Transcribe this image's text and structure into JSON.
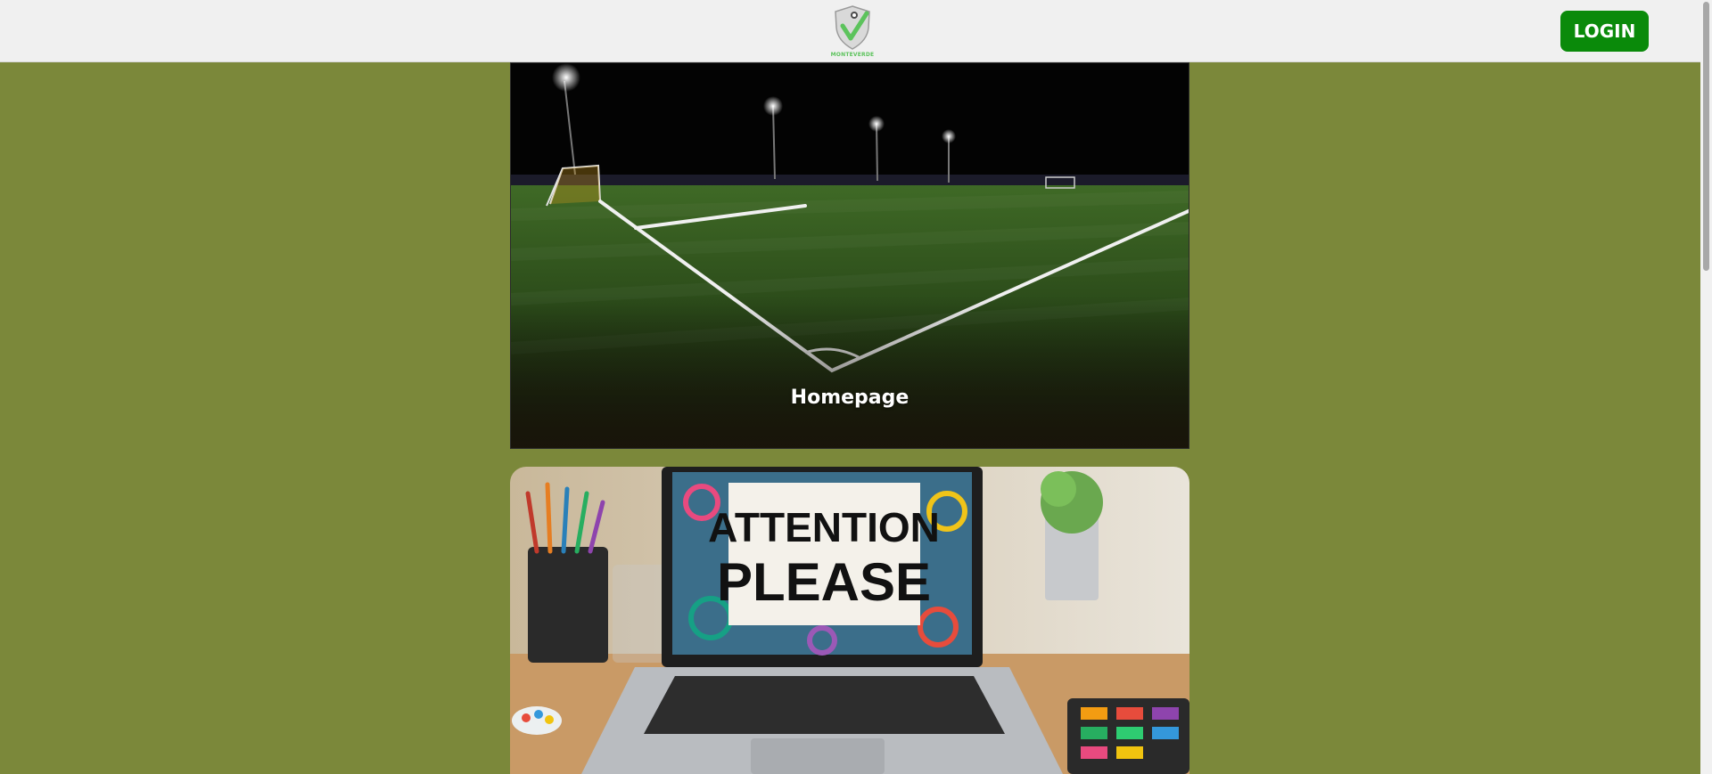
{
  "header": {
    "logo_text": "MONTEVERDE",
    "login_label": "LOGIN"
  },
  "cards": [
    {
      "title": "Homepage",
      "image": "night-soccer-field"
    },
    {
      "image": "laptop-attention-please",
      "sign_line1": "ATTENTION",
      "sign_line2": "PLEASE"
    }
  ],
  "colors": {
    "page_background": "#7b883a",
    "header_background": "#f0f0f0",
    "login_button": "#0a8a0a",
    "logo_green": "#5cc35c"
  }
}
